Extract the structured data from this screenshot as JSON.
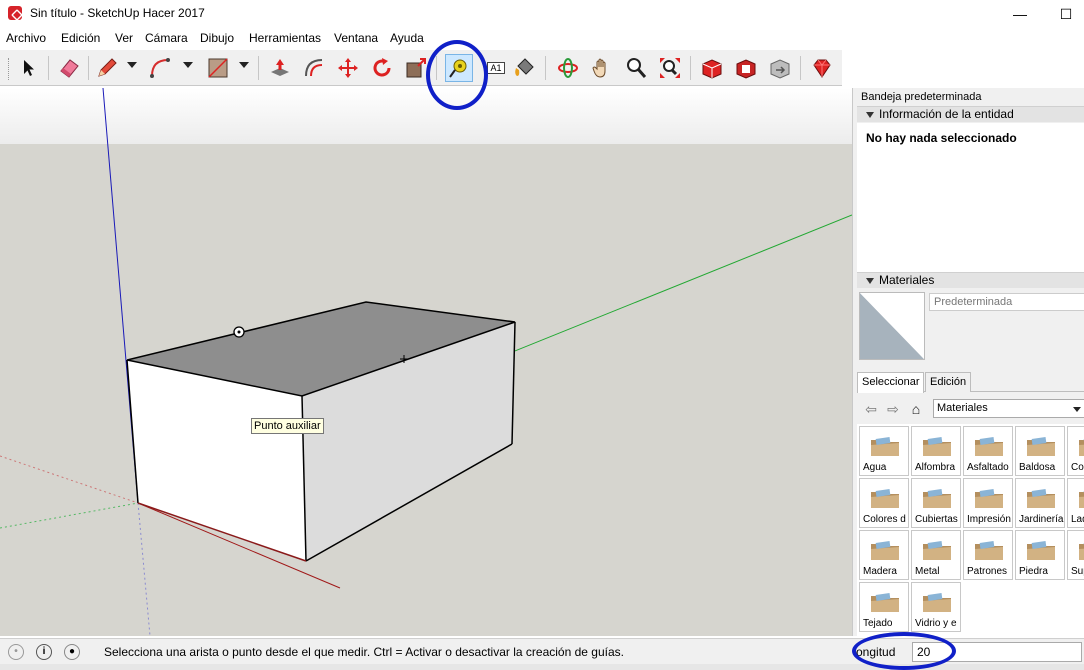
{
  "window": {
    "title": "Sin título - SketchUp Hacer 2017",
    "minimize": "—",
    "maximize": "☐"
  },
  "menu": [
    "Archivo",
    "Edición",
    "Ver",
    "Cámara",
    "Dibujo",
    "Herramientas",
    "Ventana",
    "Ayuda"
  ],
  "toolbar": {
    "tools": [
      {
        "name": "select",
        "icon": "arrow-icon"
      },
      {
        "name": "eraser",
        "icon": "eraser-icon"
      },
      {
        "name": "line",
        "icon": "pencil-icon"
      },
      {
        "name": "arc",
        "icon": "arc-icon"
      },
      {
        "name": "rectangle",
        "icon": "rectangle-icon"
      },
      {
        "name": "push-pull",
        "icon": "push-pull-icon"
      },
      {
        "name": "offset",
        "icon": "offset-icon"
      },
      {
        "name": "move",
        "icon": "move-icon"
      },
      {
        "name": "rotate",
        "icon": "rotate-icon"
      },
      {
        "name": "scale",
        "icon": "scale-icon"
      },
      {
        "name": "tape-measure",
        "icon": "tape-measure-icon",
        "active": true
      },
      {
        "name": "text",
        "icon": "text-icon",
        "label": "A1"
      },
      {
        "name": "paint-bucket",
        "icon": "paint-bucket-icon"
      },
      {
        "name": "orbit",
        "icon": "orbit-icon"
      },
      {
        "name": "pan",
        "icon": "pan-hand-icon"
      },
      {
        "name": "zoom",
        "icon": "zoom-icon"
      },
      {
        "name": "zoom-extents",
        "icon": "zoom-extents-icon"
      },
      {
        "name": "3d-warehouse",
        "icon": "warehouse-icon"
      },
      {
        "name": "extension-warehouse",
        "icon": "extension-warehouse-icon"
      },
      {
        "name": "share-model",
        "icon": "share-model-icon"
      },
      {
        "name": "extension-manager",
        "icon": "ruby-icon"
      }
    ]
  },
  "viewport": {
    "tooltip": "Punto auxiliar"
  },
  "tray": {
    "title": "Bandeja predeterminada",
    "entity_info": {
      "header": "Información de la entidad",
      "status": "No hay nada seleccionado"
    },
    "materials": {
      "header": "Materiales",
      "current": "Predeterminada",
      "tabs": [
        "Seleccionar",
        "Edición"
      ],
      "collection": "Materiales",
      "items": [
        "Agua",
        "Alfombra",
        "Asfaltado",
        "Baldosa",
        "Co",
        "Colores d",
        "Cubiertas",
        "Impresión",
        "Jardinería",
        "Lad",
        "Madera",
        "Metal",
        "Patrones",
        "Piedra",
        "Sup",
        "Tejado",
        "Vidrio y e"
      ]
    }
  },
  "statusbar": {
    "message": "Selecciona una arista o punto desde el que medir. Ctrl = Activar o desactivar la creación de guías.",
    "vcb_label": "ongitud",
    "vcb_value": "20"
  },
  "colors": {
    "accent": "#1020c8",
    "folder": "#c4a67a",
    "sky": "#f7f7f7",
    "ground": "#d6d5cf"
  }
}
